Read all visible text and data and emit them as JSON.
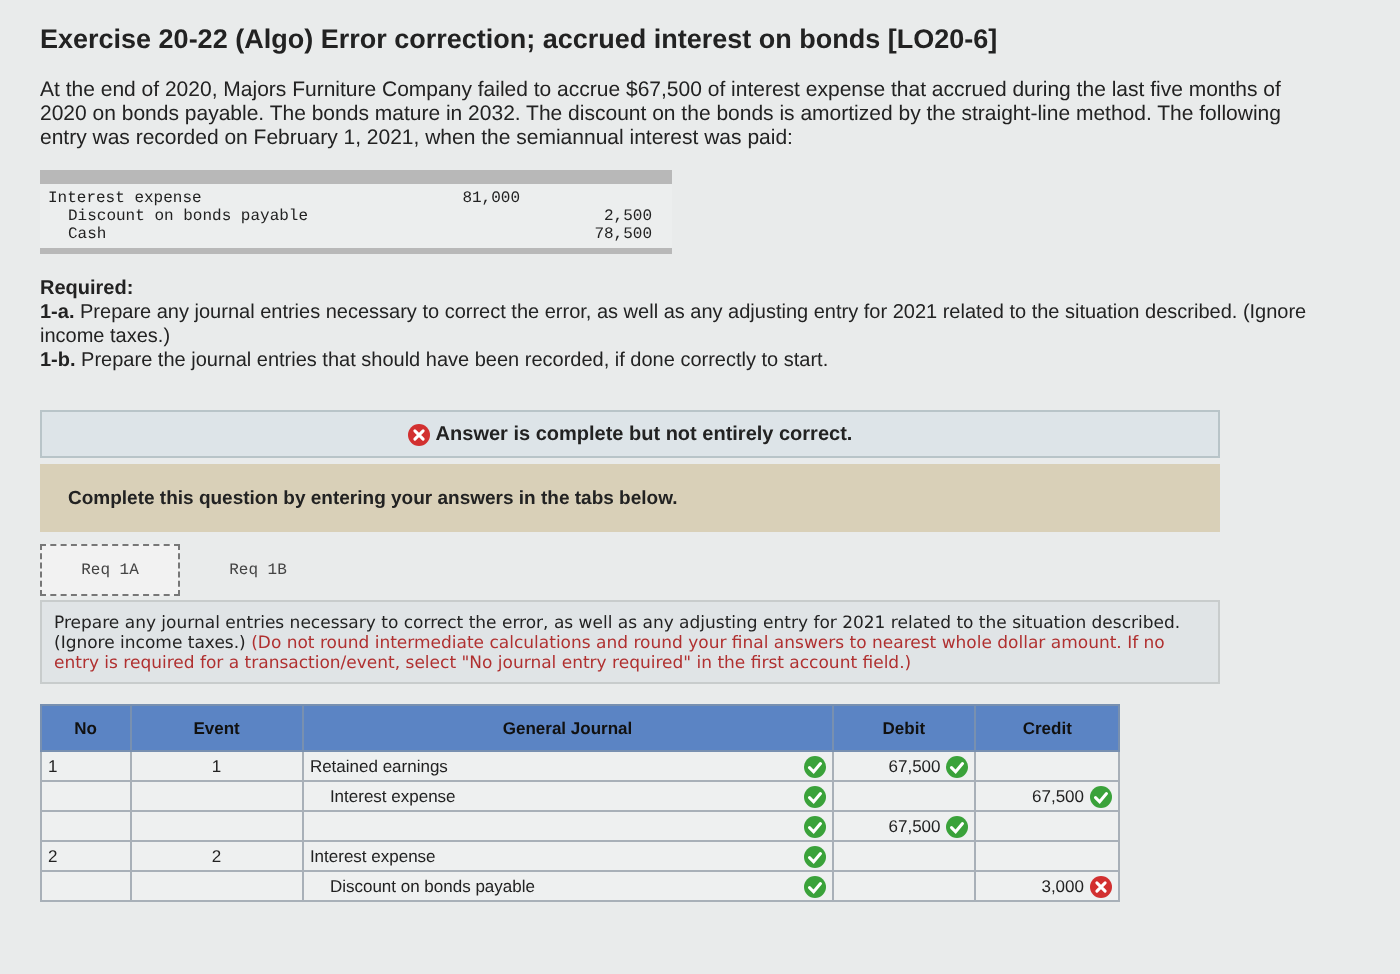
{
  "title": "Exercise 20-22 (Algo) Error correction; accrued interest on bonds [LO20-6]",
  "intro": "At the end of 2020, Majors Furniture Company failed to accrue $67,500 of interest expense that accrued during the last five months of 2020 on bonds payable. The bonds mature in 2032. The discount on the bonds is amortized by the straight-line method. The following entry was recorded on February 1, 2021, when the semiannual interest was paid:",
  "entry": [
    {
      "account": "Interest expense",
      "indented": false,
      "debit": "81,000"
    },
    {
      "account": "Discount on bonds payable",
      "indented": true,
      "credit": "2,500"
    },
    {
      "account": "Cash",
      "indented": true,
      "credit": "78,500"
    }
  ],
  "required": {
    "heading": "Required:",
    "items": [
      "**1-a.** Prepare any journal entries necessary to correct the error, as well as any adjusting entry for 2021 related to the situation described. (Ignore income taxes.)",
      "**1-b.** Prepare the journal entries that should have been recorded, if done correctly to start."
    ]
  },
  "result": {
    "correct": false,
    "message": "Answer is complete but not entirely correct."
  },
  "prompt": "Complete this question by entering your answers in the tabs below.",
  "tabs": [
    {
      "label": "Req 1A",
      "selected": true
    },
    {
      "label": "Req 1B",
      "selected": false
    }
  ],
  "instructions": "Prepare any journal entries necessary to correct the error, as well as any adjusting entry for 2021 related to the situation described. (Ignore income taxes.)",
  "instructions_note": "(Do not round intermediate calculations and round your final answers to nearest whole dollar amount. If no entry is required for a transaction/event, select \"No journal entry required\" in the first account field.)",
  "journal": {
    "columns": [
      "No",
      "Event",
      "General Journal",
      "Debit",
      "Credit"
    ],
    "rows": [
      {
        "no": "1",
        "event": "1",
        "account": "Retained earnings",
        "indented": false,
        "account_correct": true,
        "debit": "67,500",
        "debit_correct": true
      },
      {
        "account": "Interest expense",
        "indented": true,
        "account_correct": true,
        "credit": "67,500",
        "credit_correct": true
      },
      {
        "account_correct": true,
        "debit": "67,500",
        "debit_correct": true
      },
      {
        "no": "2",
        "event": "2",
        "account": "Interest expense",
        "indented": false,
        "account_correct": true
      },
      {
        "account": "Discount on bonds payable",
        "indented": true,
        "account_correct": true,
        "credit": "3,000",
        "credit_correct": false
      }
    ]
  }
}
